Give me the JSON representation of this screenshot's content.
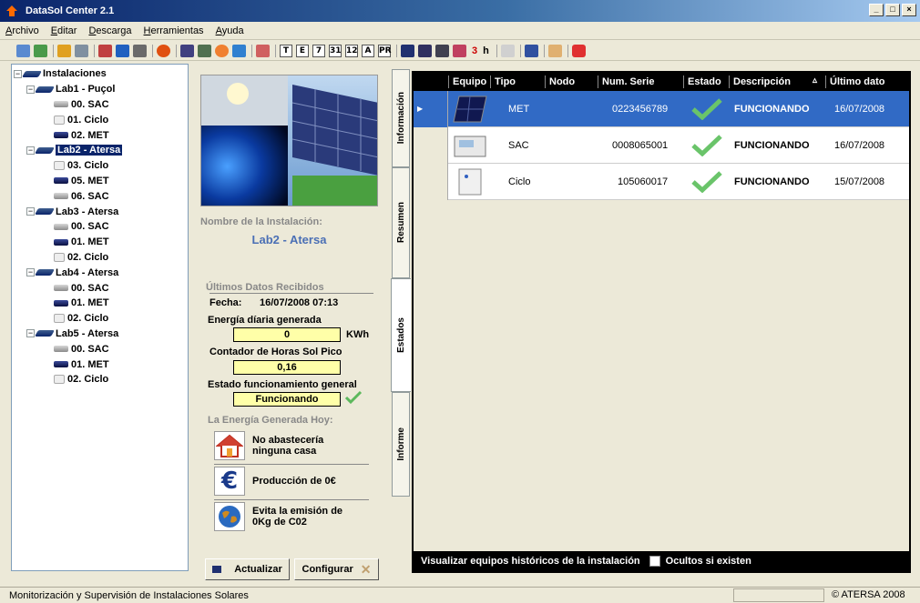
{
  "window": {
    "title": "DataSol Center 2.1"
  },
  "menu": [
    "Archivo",
    "Editar",
    "Descarga",
    "Herramientas",
    "Ayuda"
  ],
  "toolbar": {
    "text_buttons": [
      "3",
      "h"
    ],
    "letter_icons": [
      "T",
      "E",
      "7",
      "31",
      "12",
      "A",
      "PR"
    ]
  },
  "tree": {
    "root": "Instalaciones",
    "groups": [
      {
        "label": "Lab1 - Puçol",
        "children": [
          "00. SAC",
          "01. Ciclo",
          "02. MET"
        ],
        "types": [
          "sac",
          "ciclo",
          "met"
        ]
      },
      {
        "label": "Lab2 - Atersa",
        "selected": true,
        "children": [
          "03. Ciclo",
          "05. MET",
          "06. SAC"
        ],
        "types": [
          "ciclo",
          "met",
          "sac"
        ]
      },
      {
        "label": "Lab3 - Atersa",
        "children": [
          "00. SAC",
          "01. MET",
          "02. Ciclo"
        ],
        "types": [
          "sac",
          "met",
          "ciclo"
        ]
      },
      {
        "label": "Lab4 - Atersa",
        "children": [
          "00. SAC",
          "01. MET",
          "02. Ciclo"
        ],
        "types": [
          "sac",
          "met",
          "ciclo"
        ]
      },
      {
        "label": "Lab5 - Atersa",
        "children": [
          "00. SAC",
          "01. MET",
          "02. Ciclo"
        ],
        "types": [
          "sac",
          "met",
          "ciclo"
        ]
      }
    ]
  },
  "panel": {
    "name_label": "Nombre de la Instalación:",
    "name_value": "Lab2 - Atersa",
    "last_data_label": "Últimos Datos Recibidos",
    "fecha_label": "Fecha:",
    "fecha_value": "16/07/2008 07:13",
    "energia_label": "Energía díaria generada",
    "energia_value": "0",
    "energia_unit": "KWh",
    "horas_label": "Contador de Horas Sol Pico",
    "horas_value": "0,16",
    "estado_label": "Estado funcionamiento general",
    "estado_value": "Funcionando",
    "hoy_label": "La Energía Generada Hoy:",
    "casa_text_1": "No abastecería",
    "casa_text_2": "ninguna casa",
    "produccion_text": "Producción de 0€",
    "emision_text_1": "Evita la emisión de",
    "emision_text_2": "0Kg de C02",
    "actualizar": "Actualizar",
    "configurar": "Configurar"
  },
  "tabs": [
    "Información",
    "Resumen",
    "Estados",
    "Informe"
  ],
  "active_tab": "Estados",
  "grid": {
    "columns": [
      "Equipo",
      "Tipo",
      "Nodo",
      "Num. Serie",
      "Estado",
      "Descripción",
      "Último dato"
    ],
    "sort_glyph": "▵",
    "rows": [
      {
        "tipo": "MET",
        "serie": "0223456789",
        "desc": "FUNCIONANDO",
        "ultimo": "16/07/2008",
        "selected": true
      },
      {
        "tipo": "SAC",
        "serie": "0008065001",
        "desc": "FUNCIONANDO",
        "ultimo": "16/07/2008"
      },
      {
        "tipo": "Ciclo",
        "serie": "105060017",
        "desc": "FUNCIONANDO",
        "ultimo": "15/07/2008"
      }
    ],
    "footer_label": "Visualizar equipos históricos de la instalación",
    "footer_check": "Ocultos si existen"
  },
  "status": {
    "left": "Monitorización y Supervisión de Instalaciones Solares",
    "right": "© ATERSA 2008"
  },
  "colors": {
    "title_start": "#0a246a",
    "selection": "#316ac5",
    "field_bg": "#ffffa8",
    "link_blue": "#4a6fb5",
    "check_green": "#4caf50"
  }
}
